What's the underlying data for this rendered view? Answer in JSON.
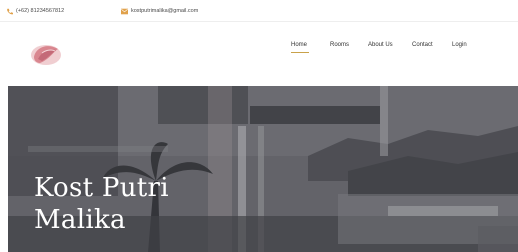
{
  "topbar": {
    "phone": "(+62) 81234567812",
    "email": "kostputrimalika@gmail.com",
    "phone_icon": "phone-icon",
    "email_icon": "envelope-icon",
    "accent_color": "#e0a14a"
  },
  "navbar": {
    "logo_icon": "brand-logo",
    "items": [
      {
        "label": "Home",
        "active": true
      },
      {
        "label": "Rooms",
        "active": false
      },
      {
        "label": "About Us",
        "active": false
      },
      {
        "label": "Contact",
        "active": false
      },
      {
        "label": "Login",
        "active": false
      }
    ],
    "active_color": "#c9a24a"
  },
  "hero": {
    "title_line1": "Kost Putri",
    "title_line2": "Malika"
  }
}
